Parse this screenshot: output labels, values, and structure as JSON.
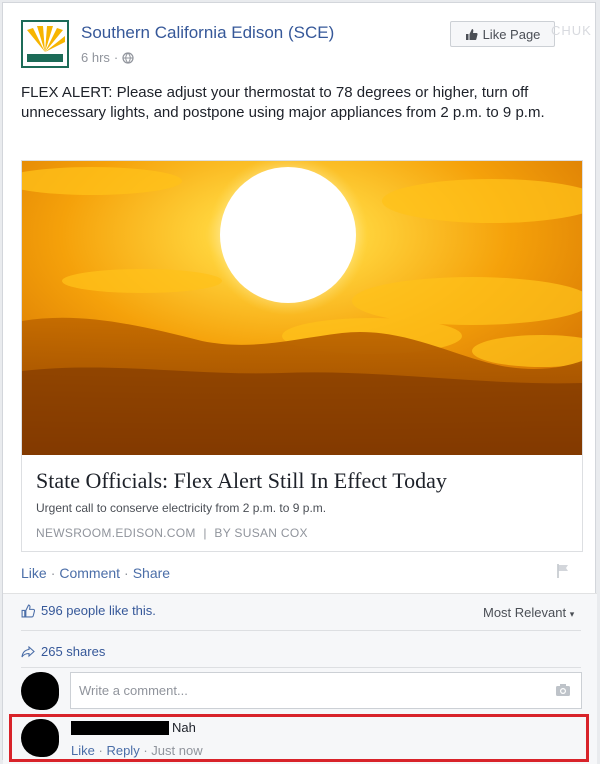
{
  "post": {
    "page_name": "Southern California Edison (SCE)",
    "time": "6 hrs",
    "audience_icon": "globe-icon",
    "like_page_label": "Like Page",
    "watermark": "CHUK",
    "text": "FLEX ALERT: Please adjust your thermostat to 78 degrees or higher, turn off unnecessary lights, and postpone using major appliances from 2 p.m. to 9 p.m."
  },
  "link_preview": {
    "title": "State Officials: Flex Alert Still In Effect Today",
    "description": "Urgent call to conserve electricity from 2 p.m. to 9 p.m.",
    "source": "NEWSROOM.EDISON.COM",
    "author": "BY SUSAN COX",
    "source_sep": "|"
  },
  "actions": {
    "like": "Like",
    "comment": "Comment",
    "share": "Share",
    "sep": "·"
  },
  "social": {
    "likes_text": "596 people like this.",
    "sort_label": "Most Relevant",
    "sort_caret": "▾",
    "shares_text": "265 shares"
  },
  "composer": {
    "placeholder": "Write a comment..."
  },
  "comment": {
    "text": "Nah",
    "like": "Like",
    "reply": "Reply",
    "time": "Just now",
    "sep": "·"
  },
  "colors": {
    "link_blue": "#365899",
    "highlight_red": "#d8232a",
    "logo_green": "#1c6b57",
    "logo_yellow": "#f7b500"
  }
}
